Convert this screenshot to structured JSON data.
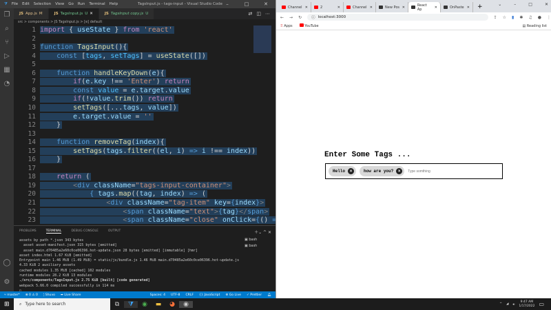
{
  "vscode": {
    "menu": [
      "File",
      "Edit",
      "Selection",
      "View",
      "Go",
      "Run",
      "Terminal",
      "Help"
    ],
    "title": "TagsInput.js - tags-input - Visual Studio Code",
    "tabs": [
      {
        "label": "App.js",
        "badge": "M"
      },
      {
        "label": "TagsInput.js",
        "badge": "U"
      },
      {
        "label": "TagsInput copy.js",
        "badge": "U"
      }
    ],
    "breadcrumb": "src > components > JS TagsInput.js > [e] default",
    "code": [
      [
        [
          "kw",
          "import"
        ],
        [
          "op",
          " { "
        ],
        [
          "var",
          "useState"
        ],
        [
          "op",
          " } "
        ],
        [
          "kw",
          "from"
        ],
        [
          "str",
          " 'react'"
        ]
      ],
      [],
      [
        [
          "tn",
          "function"
        ],
        [
          "fn",
          " TagsInput"
        ],
        [
          "op",
          "(){"
        ]
      ],
      [
        [
          "op",
          "    "
        ],
        [
          "tn",
          "const"
        ],
        [
          "op",
          " ["
        ],
        [
          "cst",
          "tags"
        ],
        [
          "op",
          ", "
        ],
        [
          "cst",
          "setTags"
        ],
        [
          "op",
          "] = "
        ],
        [
          "fn",
          "useState"
        ],
        [
          "op",
          "([])"
        ]
      ],
      [],
      [
        [
          "op",
          "    "
        ],
        [
          "tn",
          "function"
        ],
        [
          "fn",
          " handleKeyDown"
        ],
        [
          "op",
          "("
        ],
        [
          "var",
          "e"
        ],
        [
          "op",
          "){"
        ]
      ],
      [
        [
          "op",
          "        "
        ],
        [
          "kw",
          "if"
        ],
        [
          "op",
          "("
        ],
        [
          "var",
          "e"
        ],
        [
          "op",
          "."
        ],
        [
          "var",
          "key"
        ],
        [
          "op",
          " !== "
        ],
        [
          "str",
          "'Enter'"
        ],
        [
          "op",
          ") "
        ],
        [
          "kw",
          "return"
        ]
      ],
      [
        [
          "op",
          "        "
        ],
        [
          "tn",
          "const"
        ],
        [
          "cst",
          " value"
        ],
        [
          "op",
          " = "
        ],
        [
          "var",
          "e"
        ],
        [
          "op",
          "."
        ],
        [
          "var",
          "target"
        ],
        [
          "op",
          "."
        ],
        [
          "var",
          "value"
        ]
      ],
      [
        [
          "op",
          "        "
        ],
        [
          "kw",
          "if"
        ],
        [
          "op",
          "(!"
        ],
        [
          "var",
          "value"
        ],
        [
          "op",
          "."
        ],
        [
          "fn",
          "trim"
        ],
        [
          "op",
          "()) "
        ],
        [
          "kw",
          "return"
        ]
      ],
      [
        [
          "op",
          "        "
        ],
        [
          "fn",
          "setTags"
        ],
        [
          "op",
          "([..."
        ],
        [
          "var",
          "tags"
        ],
        [
          "op",
          ", "
        ],
        [
          "var",
          "value"
        ],
        [
          "op",
          "])"
        ]
      ],
      [
        [
          "op",
          "        "
        ],
        [
          "var",
          "e"
        ],
        [
          "op",
          "."
        ],
        [
          "var",
          "target"
        ],
        [
          "op",
          "."
        ],
        [
          "var",
          "value"
        ],
        [
          "op",
          " = "
        ],
        [
          "str",
          "''"
        ]
      ],
      [
        [
          "op",
          "    }"
        ]
      ],
      [],
      [
        [
          "op",
          "    "
        ],
        [
          "tn",
          "function"
        ],
        [
          "fn",
          " removeTag"
        ],
        [
          "op",
          "("
        ],
        [
          "var",
          "index"
        ],
        [
          "op",
          "){"
        ]
      ],
      [
        [
          "op",
          "        "
        ],
        [
          "fn",
          "setTags"
        ],
        [
          "op",
          "("
        ],
        [
          "var",
          "tags"
        ],
        [
          "op",
          "."
        ],
        [
          "fn",
          "filter"
        ],
        [
          "op",
          "(("
        ],
        [
          "var",
          "el"
        ],
        [
          "op",
          ", "
        ],
        [
          "var",
          "i"
        ],
        [
          "op",
          ") "
        ],
        [
          "tn",
          "=>"
        ],
        [
          "var",
          " i"
        ],
        [
          "op",
          " !== "
        ],
        [
          "var",
          "index"
        ],
        [
          "op",
          "))"
        ]
      ],
      [
        [
          "op",
          "    }"
        ]
      ],
      [],
      [
        [
          "op",
          "    "
        ],
        [
          "kw",
          "return"
        ],
        [
          "op",
          " ("
        ]
      ],
      [
        [
          "op",
          "        "
        ],
        [
          "tg",
          "<"
        ],
        [
          "tn",
          "div"
        ],
        [
          "var",
          " className"
        ],
        [
          "op",
          "="
        ],
        [
          "str",
          "\"tags-input-container\""
        ],
        [
          "tg",
          ">"
        ]
      ],
      [
        [
          "op",
          "            "
        ],
        [
          "tn",
          "{"
        ],
        [
          "var",
          " tags"
        ],
        [
          "op",
          "."
        ],
        [
          "fn",
          "map"
        ],
        [
          "op",
          "(("
        ],
        [
          "var",
          "tag"
        ],
        [
          "op",
          ", "
        ],
        [
          "var",
          "index"
        ],
        [
          "op",
          ") "
        ],
        [
          "tn",
          "=>"
        ],
        [
          "op",
          " ("
        ]
      ],
      [
        [
          "op",
          "                "
        ],
        [
          "tg",
          "<"
        ],
        [
          "tn",
          "div"
        ],
        [
          "var",
          " className"
        ],
        [
          "op",
          "="
        ],
        [
          "str",
          "\"tag-item\""
        ],
        [
          "var",
          " key"
        ],
        [
          "op",
          "="
        ],
        [
          "tn",
          "{"
        ],
        [
          "var",
          "index"
        ],
        [
          "tn",
          "}"
        ],
        [
          "tg",
          ">"
        ]
      ],
      [
        [
          "op",
          "                    "
        ],
        [
          "tg",
          "<"
        ],
        [
          "tn",
          "span"
        ],
        [
          "var",
          " className"
        ],
        [
          "op",
          "="
        ],
        [
          "str",
          "\"text\""
        ],
        [
          "tg",
          ">"
        ],
        [
          "tn",
          "{"
        ],
        [
          "var",
          "tag"
        ],
        [
          "tn",
          "}"
        ],
        [
          "tg",
          "</"
        ],
        [
          "tn",
          "span"
        ],
        [
          "tg",
          ">"
        ]
      ],
      [
        [
          "op",
          "                    "
        ],
        [
          "tg",
          "<"
        ],
        [
          "tn",
          "span"
        ],
        [
          "var",
          " className"
        ],
        [
          "op",
          "="
        ],
        [
          "str",
          "\"close\""
        ],
        [
          "var",
          " onClick"
        ],
        [
          "op",
          "="
        ],
        [
          "tn",
          "{"
        ],
        [
          "op",
          "() "
        ],
        [
          "tn",
          "=>"
        ],
        [
          "var",
          " re"
        ]
      ]
    ],
    "panel_tabs": [
      "PROBLEMS",
      "TERMINAL",
      "DEBUG CONSOLE",
      "OUTPUT"
    ],
    "terminal": [
      "assets by path *.json 343 bytes",
      "  asset asset-manifest.json 315 bytes [emitted]",
      "  asset main.d70485a2e60c0ce06396.hot-update.json 28 bytes [emitted] [immutable] [hmr]",
      "asset index.html 1.67 KiB [emitted]",
      "Entrypoint main 1.46 MiB (1.49 MiB) = static/js/bundle.js 1.46 MiB main.d70485a2e60c0ce06396.hot-update.js",
      "4.33 KiB 2 auxiliary assets",
      "cached modules 1.35 MiB [cached] 102 modules",
      "runtime modules 28.2 KiB 13 modules",
      "./src/components/TagsInput.js 2.75 KiB [built] [code generated]",
      "webpack 5.66.0 compiled successfully in 114 ms"
    ],
    "shells": [
      "bash",
      "bash"
    ],
    "status": {
      "branch": "master*",
      "errors": "0",
      "warnings": "0",
      "user": "Shuvo",
      "liveshare": "Live Share",
      "spaces": "Spaces: 4",
      "encoding": "UTF-8",
      "eol": "CRLF",
      "language": "JavaScript",
      "golive": "Go Live",
      "prettier": "Prettier"
    }
  },
  "browser": {
    "tabs": [
      "Channel",
      "2",
      "Channel",
      "New Pos",
      "React Ap",
      "OnPaste"
    ],
    "url": "localhost:3000",
    "bookmarks": [
      "Apps",
      "YouTube"
    ],
    "reading_list": "Reading list",
    "page": {
      "heading": "Enter Some Tags ...",
      "tags": [
        "Hello",
        "how are you?"
      ],
      "placeholder": "Type somthing"
    }
  },
  "taskbar": {
    "search_placeholder": "Type here to search",
    "time": "9:47 AM",
    "date": "1/17/2022"
  }
}
